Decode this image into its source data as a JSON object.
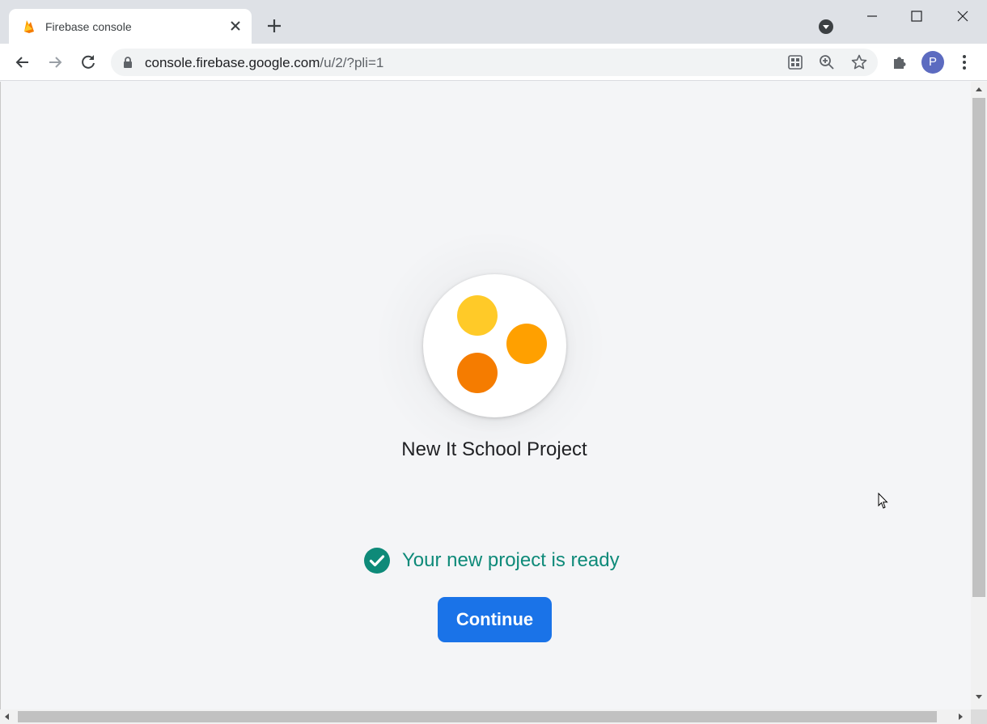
{
  "browser": {
    "tab_title": "Firebase console",
    "url_host": "console.firebase.google.com",
    "url_path": "/u/2/?pli=1",
    "profile_initial": "P",
    "icons": {
      "favicon": "firebase-flame-icon",
      "close_tab": "close-icon",
      "new_tab": "plus-icon",
      "tab_search": "chevron-down-icon",
      "back": "arrow-left-icon",
      "forward": "arrow-right-icon",
      "reload": "reload-icon",
      "lock": "lock-icon",
      "qr": "qr-code-icon",
      "zoom": "zoom-in-icon",
      "bookmark": "star-icon",
      "extensions": "puzzle-icon",
      "menu": "more-vertical-icon"
    }
  },
  "page": {
    "project_name": "New It School Project",
    "status_text": "Your new project is ready",
    "continue_label": "Continue",
    "colors": {
      "status": "#0e8a79",
      "button": "#1a73e8",
      "dot_1": "#ffca28",
      "dot_2": "#ffa000",
      "dot_3": "#f57c00"
    }
  }
}
